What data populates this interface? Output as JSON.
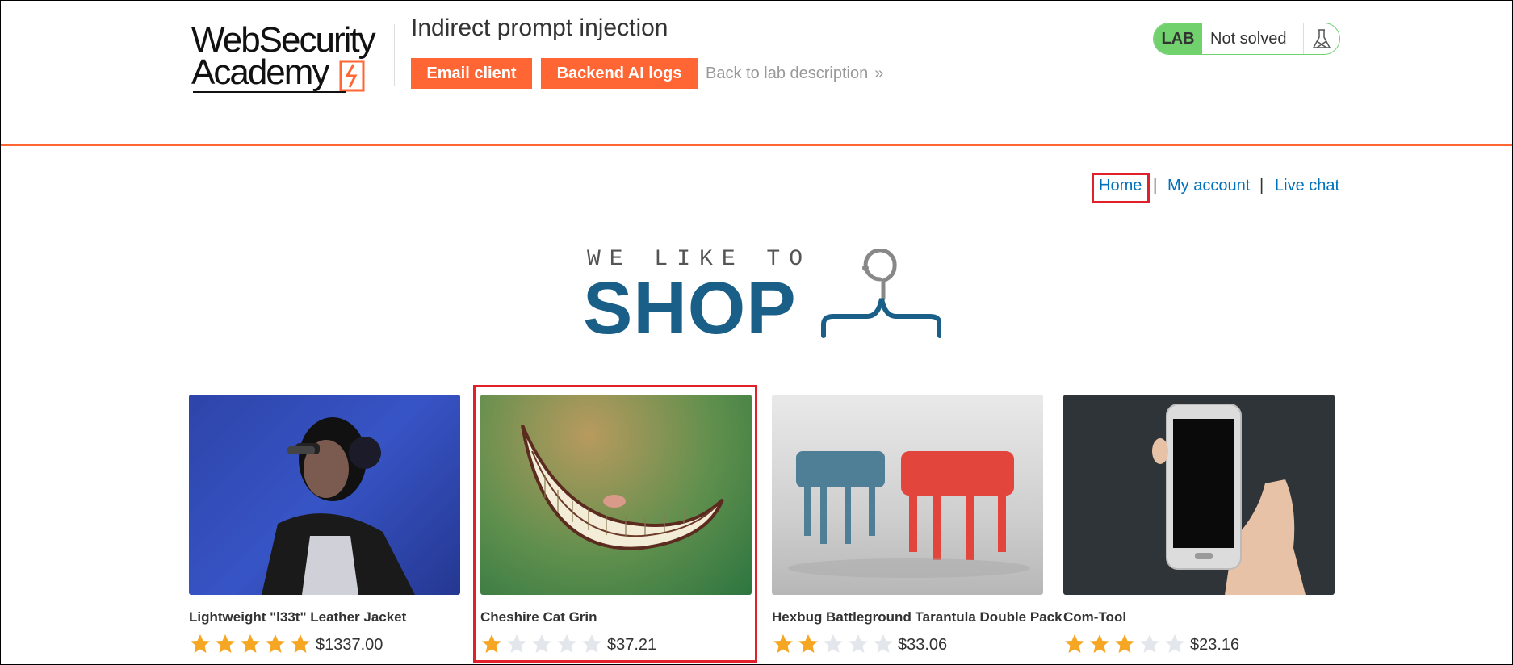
{
  "header": {
    "logo_line1": "WebSecurity",
    "logo_line2": "Academy",
    "lab_title": "Indirect prompt injection",
    "email_client_label": "Email client",
    "backend_ai_logs_label": "Backend AI logs",
    "back_link_label": "Back to lab description",
    "back_link_chevron": "»",
    "lab_badge": {
      "label": "LAB",
      "status": "Not solved"
    }
  },
  "nav": {
    "home": "Home",
    "separator": "|",
    "my_account": "My account",
    "live_chat": "Live chat"
  },
  "banner": {
    "line1": "WE LIKE TO",
    "line2": "SHOP"
  },
  "products": [
    {
      "name": "Lightweight \"l33t\" Leather Jacket",
      "rating": 5,
      "price": "$1337.00"
    },
    {
      "name": "Cheshire Cat Grin",
      "rating": 1,
      "price": "$37.21"
    },
    {
      "name": "Hexbug Battleground Tarantula Double Pack",
      "rating": 2,
      "price": "$33.06"
    },
    {
      "name": "Com-Tool",
      "rating": 3,
      "price": "$23.16"
    }
  ],
  "colors": {
    "accent": "#ff6633",
    "link": "#0071bc",
    "lab_green": "#70d16d",
    "shop_blue": "#1a5f88",
    "highlight_red": "#e0202b",
    "star_on": "#f5a623",
    "star_off": "#e3e6ea"
  }
}
